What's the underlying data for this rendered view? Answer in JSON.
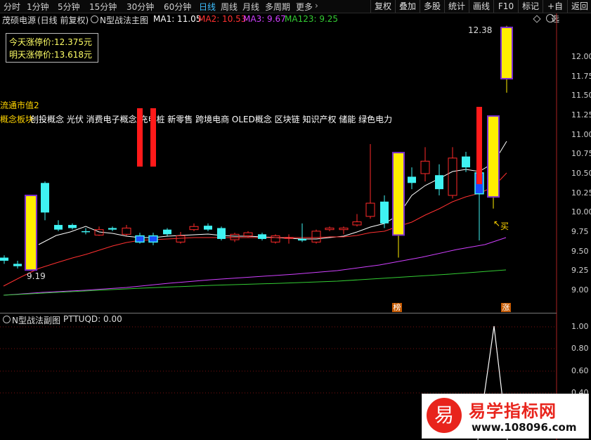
{
  "toolbar": {
    "timeframes": [
      "分时",
      "1分钟",
      "5分钟",
      "15分钟",
      "30分钟",
      "60分钟",
      "日线",
      "周线",
      "月线",
      "多周期",
      "更多"
    ],
    "active_timeframe": "日线",
    "buttons": [
      "复权",
      "叠加",
      "多股",
      "统计",
      "画线",
      "F10",
      "标记",
      "+自选",
      "返回"
    ]
  },
  "main_info": {
    "stock": "茂硕电源",
    "mode": "(日线 前复权)",
    "indicator": "N型战法主图",
    "ma1": "MA1: 11.05",
    "ma2": "MA2: 10.53",
    "ma3": "MA3: 9.67",
    "ma123": "MA123: 9.25"
  },
  "price_box": {
    "today_limit": "今天涨停价:12.375元",
    "tomorrow_limit": "明天涨停价:13.618元"
  },
  "labels": {
    "float_cap": "流通市值2",
    "concept_prefix": "概念板块",
    "concepts": "创投概念 光伏 消费电子概念 充电桩 新零售 跨境电商 OLED概念 区块链 知识产权 储能 绿色电力",
    "high_label": "12.38",
    "low_label": "9.19",
    "buy_label": "买",
    "bang_marker": "榜",
    "zhang_marker": "涨"
  },
  "price_axis": [
    "12.00",
    "11.75",
    "11.50",
    "11.25",
    "11.00",
    "10.75",
    "10.50",
    "10.25",
    "10.00",
    "9.75",
    "9.50",
    "9.25",
    "9.00"
  ],
  "sub_info": {
    "indicator": "N型战法副图",
    "value": "PTTUQD: 0.00"
  },
  "sub_axis": [
    "1.00",
    "0.80",
    "0.60",
    "0.40"
  ],
  "watermark": {
    "brand": "易学指标网",
    "url": "www.108096.com",
    "glyph": "易"
  },
  "colors": {
    "up": "#ff2a2a",
    "down": "#3ff2f2",
    "limit_up": "#ffee00",
    "limit_edge": "#7b2fd0",
    "ma1": "#ffffff",
    "ma2": "#ff3030",
    "ma3": "#d040ff",
    "ma123": "#33cc33"
  }
}
